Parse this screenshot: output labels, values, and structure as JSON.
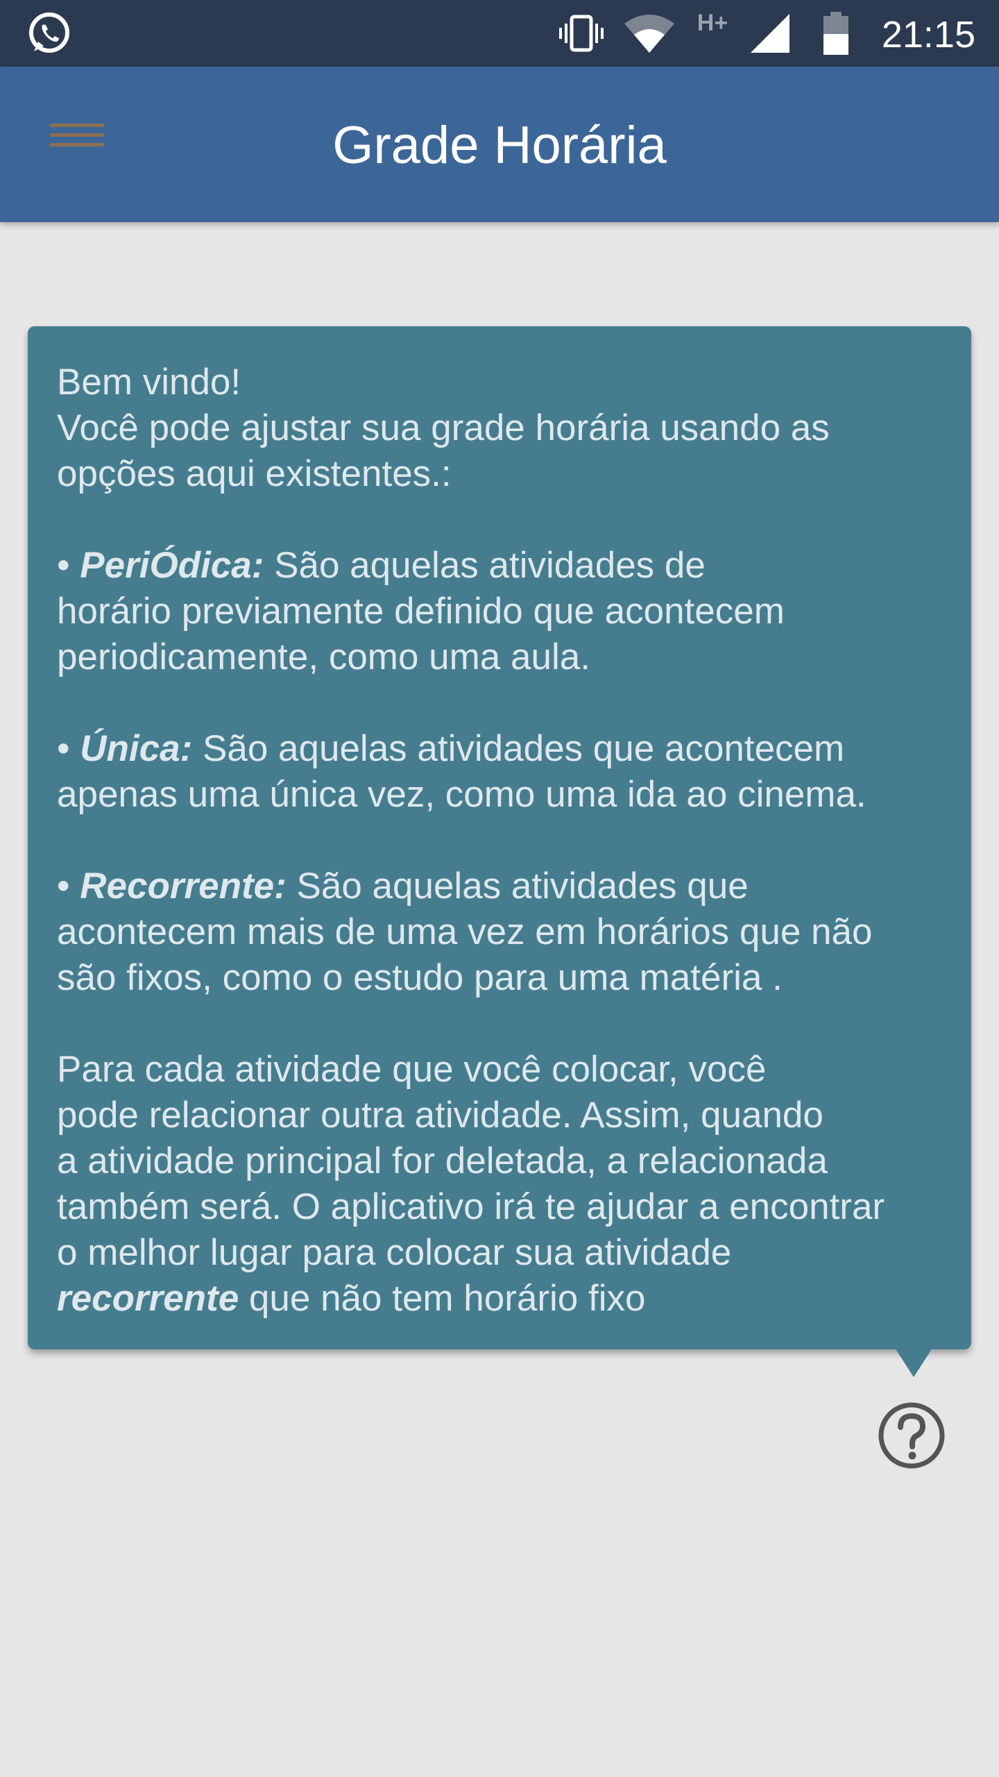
{
  "status_bar": {
    "time": "21:15",
    "network_type": "H+",
    "icons": [
      "whatsapp-icon",
      "vibrate-icon",
      "wifi-icon",
      "signal-icon",
      "battery-icon"
    ]
  },
  "app_bar": {
    "title": "Grade Horária",
    "menu_icon": "hamburger-menu-icon",
    "color": "#3c6697"
  },
  "info_card": {
    "color": "#457d8f",
    "welcome": "Bem vindo!",
    "intro_line1": "Você pode ajustar sua grade horária usando as",
    "intro_line2": "opções aqui existentes.:",
    "periodica": {
      "bullet": "• ",
      "term": "PeriÓdica:",
      "text_line1": " São aquelas atividades de",
      "text_line2": "horário previamente definido que acontecem",
      "text_line3": "periodicamente, como uma aula."
    },
    "unica": {
      "bullet": "• ",
      "term": "Única:",
      "text_line1": " São aquelas atividades que acontecem",
      "text_line2": "apenas uma única vez, como uma ida ao cinema."
    },
    "recorrente": {
      "bullet": "• ",
      "term": "Recorrente:",
      "text_line1": " São aquelas atividades que",
      "text_line2": "acontecem mais de uma vez em horários que não",
      "text_line3": "são fixos, como o estudo para uma matéria ."
    },
    "footer": {
      "line1": "Para cada atividade que você colocar, você",
      "line2": "pode relacionar outra atividade. Assim, quando",
      "line3": "a atividade principal for deletada, a relacionada",
      "line4": "também será. O aplicativo irá te ajudar a encontrar",
      "line5": "o melhor lugar para colocar sua atividade",
      "line6_bold": "recorrente",
      "line6_rest": " que não tem horário fixo"
    }
  },
  "help_button": {
    "icon": "question-mark-circle-icon"
  }
}
